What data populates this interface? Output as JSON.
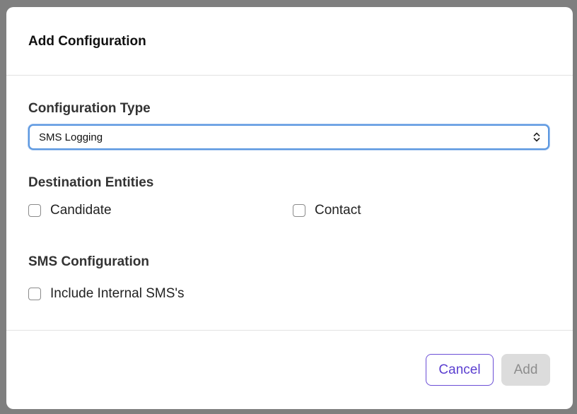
{
  "modal": {
    "title": "Add Configuration"
  },
  "config_type": {
    "label": "Configuration Type",
    "selected_value": "SMS Logging",
    "icon": "chevron-up-down-icon"
  },
  "destination": {
    "label": "Destination Entities",
    "options": [
      {
        "label": "Candidate",
        "checked": false
      },
      {
        "label": "Contact",
        "checked": false
      }
    ]
  },
  "sms_config": {
    "label": "SMS Configuration",
    "options": [
      {
        "label": "Include Internal SMS's",
        "checked": false
      }
    ]
  },
  "footer": {
    "cancel_label": "Cancel",
    "add_label": "Add"
  },
  "colors": {
    "accent": "#5b3fd0",
    "focus_border": "#5b97e0",
    "disabled_bg": "#dcdcdc",
    "disabled_text": "#8d8d8d"
  }
}
